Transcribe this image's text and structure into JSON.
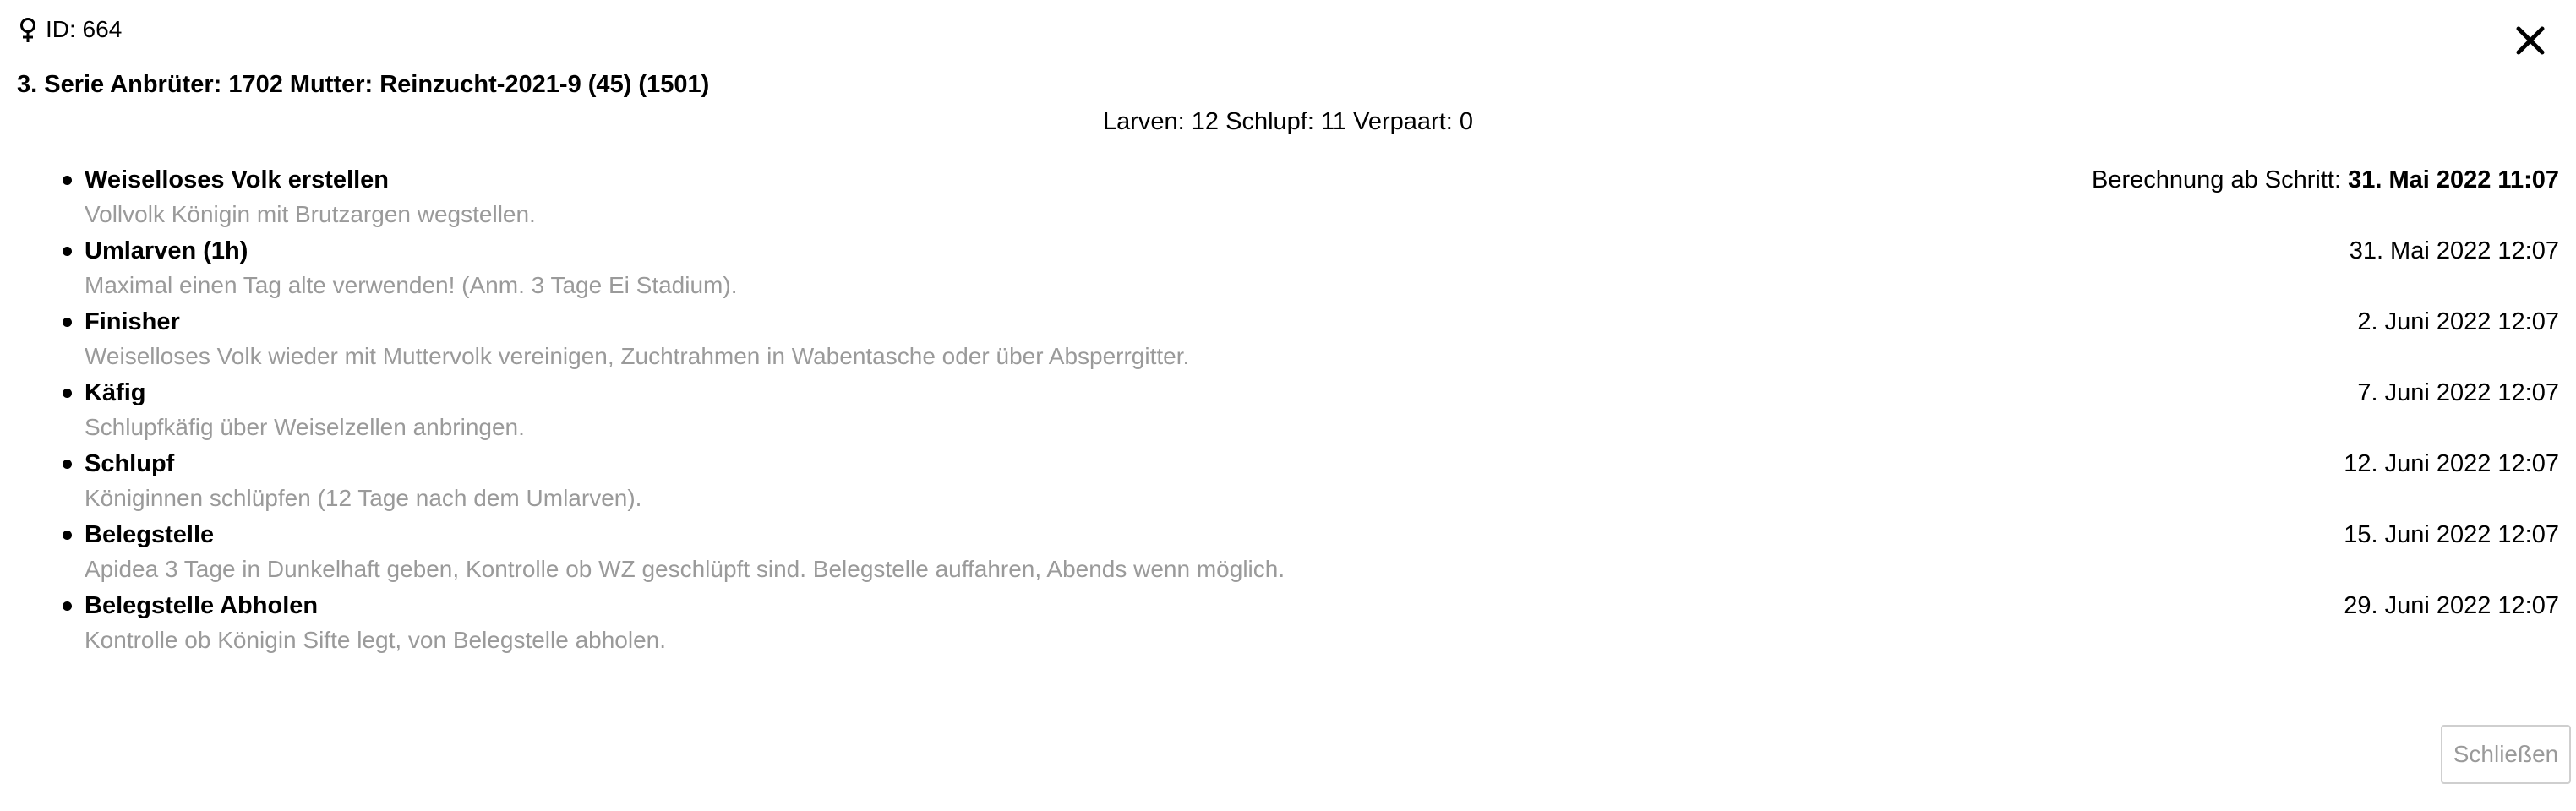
{
  "header": {
    "id_label": "ID: 664",
    "id_icon": "female-symbol-icon",
    "close_icon": "close-icon"
  },
  "serie": {
    "title": "3. Serie Anbrüter: 1702 Mutter: Reinzucht-2021-9 (45) (1501)",
    "summary": "Larven: 12 Schlupf: 11 Verpaart: 0"
  },
  "steps": [
    {
      "name": "Weiselloses Volk erstellen",
      "description": "Vollvolk Königin mit Brutzargen wegstellen.",
      "date_prefix": "Berechnung ab Schritt: ",
      "date": "31. Mai 2022 11:07"
    },
    {
      "name": "Umlarven (1h)",
      "description": "Maximal einen Tag alte verwenden! (Anm. 3 Tage Ei Stadium).",
      "date": "31. Mai 2022 12:07"
    },
    {
      "name": "Finisher",
      "description": "Weiselloses Volk wieder mit Muttervolk vereinigen, Zuchtrahmen in Wabentasche oder über Absperrgitter.",
      "date": "2. Juni 2022 12:07"
    },
    {
      "name": "Käfig",
      "description": "Schlupfkäfig über Weiselzellen anbringen.",
      "date": "7. Juni 2022 12:07"
    },
    {
      "name": "Schlupf",
      "description": "Königinnen schlüpfen (12 Tage nach dem Umlarven).",
      "date": "12. Juni 2022 12:07"
    },
    {
      "name": "Belegstelle",
      "description": "Apidea 3 Tage in Dunkelhaft geben, Kontrolle ob WZ geschlüpft sind. Belegstelle auffahren, Abends wenn möglich.",
      "date": "15. Juni 2022 12:07"
    },
    {
      "name": "Belegstelle Abholen",
      "description": "Kontrolle ob Königin Sifte legt, von Belegstelle abholen.",
      "date": "29. Juni 2022 12:07"
    }
  ],
  "footer": {
    "close_label": "Schließen"
  },
  "colors": {
    "text": "#000000",
    "muted": "#9a9a9a",
    "button_border": "#cfcfcf",
    "background": "#ffffff"
  }
}
